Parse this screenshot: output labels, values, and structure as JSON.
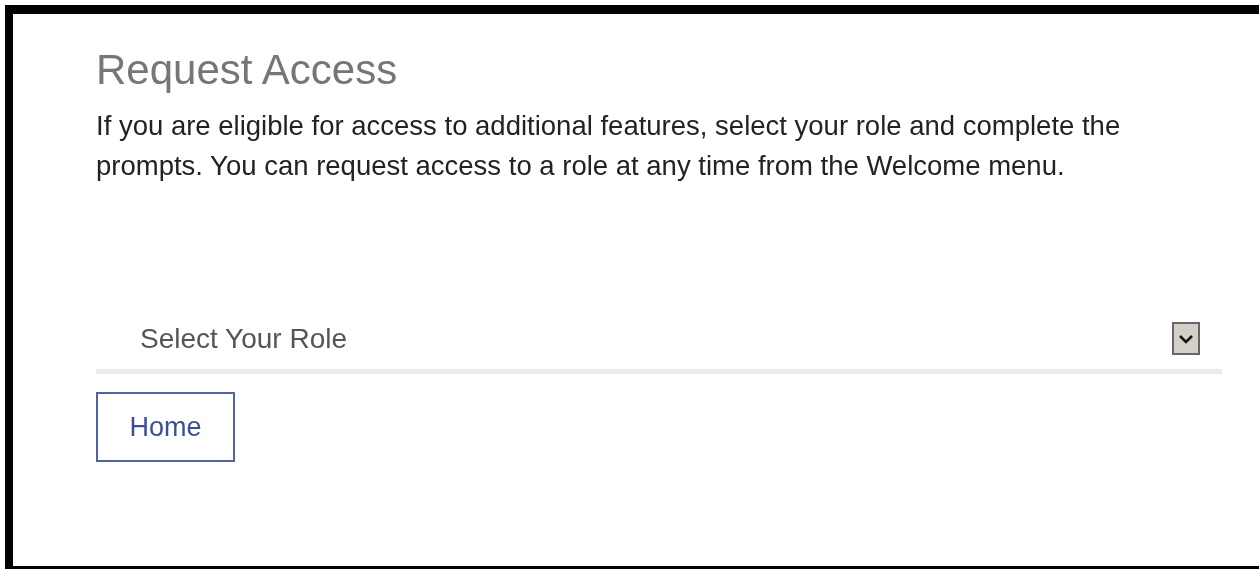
{
  "title": "Request Access",
  "description": "If you are eligible for access to additional features, select your role and complete the prompts. You can request access to a role at any time from the Welcome menu.",
  "role_select": {
    "placeholder": "Select Your Role"
  },
  "buttons": [
    {
      "label": "Home"
    }
  ]
}
